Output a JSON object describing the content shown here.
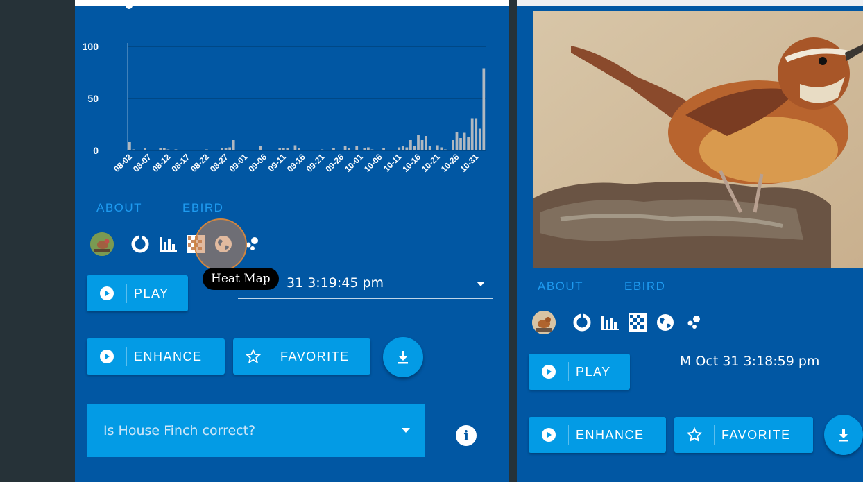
{
  "chart_data": {
    "type": "bar",
    "categories": [
      "08-02",
      "08-03",
      "08-04",
      "08-05",
      "08-06",
      "08-07",
      "08-08",
      "08-09",
      "08-10",
      "08-11",
      "08-12",
      "08-13",
      "08-14",
      "08-15",
      "08-16",
      "08-17",
      "08-18",
      "08-19",
      "08-20",
      "08-21",
      "08-22",
      "08-23",
      "08-24",
      "08-25",
      "08-26",
      "08-27",
      "08-28",
      "08-29",
      "08-30",
      "08-31",
      "09-01",
      "09-02",
      "09-03",
      "09-04",
      "09-05",
      "09-06",
      "09-07",
      "09-08",
      "09-09",
      "09-10",
      "09-11",
      "09-12",
      "09-13",
      "09-14",
      "09-15",
      "09-16",
      "09-17",
      "09-18",
      "09-19",
      "09-20",
      "09-21",
      "09-22",
      "09-23",
      "09-24",
      "09-25",
      "09-26",
      "09-27",
      "09-28",
      "09-29",
      "09-30",
      "10-01",
      "10-02",
      "10-03",
      "10-04",
      "10-05",
      "10-06",
      "10-07",
      "10-08",
      "10-09",
      "10-10",
      "10-11",
      "10-12",
      "10-13",
      "10-14",
      "10-15",
      "10-16",
      "10-17",
      "10-18",
      "10-19",
      "10-20",
      "10-21",
      "10-22",
      "10-23",
      "10-24",
      "10-25",
      "10-26",
      "10-27",
      "10-28",
      "10-29",
      "10-30",
      "10-31"
    ],
    "values": [
      8,
      1,
      0,
      0,
      2,
      0,
      0,
      0,
      2,
      2,
      1,
      0,
      1,
      0,
      0,
      0,
      0,
      0,
      0,
      0,
      1,
      0,
      0,
      0,
      2,
      2,
      3,
      10,
      0,
      0,
      0,
      0,
      0,
      0,
      4,
      0,
      0,
      0,
      0,
      2,
      2,
      2,
      0,
      5,
      2,
      0,
      0,
      0,
      0,
      0,
      1,
      0,
      0,
      2,
      0,
      0,
      4,
      2,
      0,
      4,
      0,
      2,
      3,
      1,
      0,
      0,
      2,
      0,
      0,
      0,
      3,
      4,
      3,
      10,
      4,
      15,
      10,
      14,
      4,
      0,
      5,
      3,
      1,
      0,
      10,
      18,
      12,
      17,
      13,
      31,
      31,
      21,
      79
    ],
    "tick_labels": [
      "08-02",
      "08-07",
      "08-12",
      "08-17",
      "08-22",
      "08-27",
      "09-01",
      "09-06",
      "09-11",
      "09-16",
      "09-21",
      "09-26",
      "10-01",
      "10-06",
      "10-11",
      "10-16",
      "10-21",
      "10-26",
      "10-31"
    ],
    "y_ticks": [
      "0",
      "50",
      "100"
    ],
    "ylim": [
      0,
      105
    ],
    "grid": true,
    "xlabel": "",
    "ylabel": "",
    "title": ""
  },
  "left": {
    "links": {
      "about": "ABOUT",
      "ebird": "EBIRD"
    },
    "icons": [
      "avatar-house-finch",
      "donut-chart-icon",
      "bar-chart-icon",
      "heat-map-icon",
      "globe-icon",
      "scatter-icon"
    ],
    "tooltip": "Heat Map",
    "play": "PLAY",
    "date": "31 3:19:45 pm",
    "enhance": "ENHANCE",
    "favorite": "FAVORITE",
    "question": "Is House Finch correct?"
  },
  "right": {
    "links": {
      "about": "ABOUT",
      "ebird": "EBIRD"
    },
    "play": "PLAY",
    "date": "M Oct 31 3:18:59 pm",
    "enhance": "ENHANCE",
    "favorite": "FAVORITE"
  },
  "colors": {
    "panel": "#0157a3",
    "button": "#039be5",
    "link": "#1e9bf0",
    "sidebar": "#263238",
    "bar": "#b0b8c0"
  }
}
